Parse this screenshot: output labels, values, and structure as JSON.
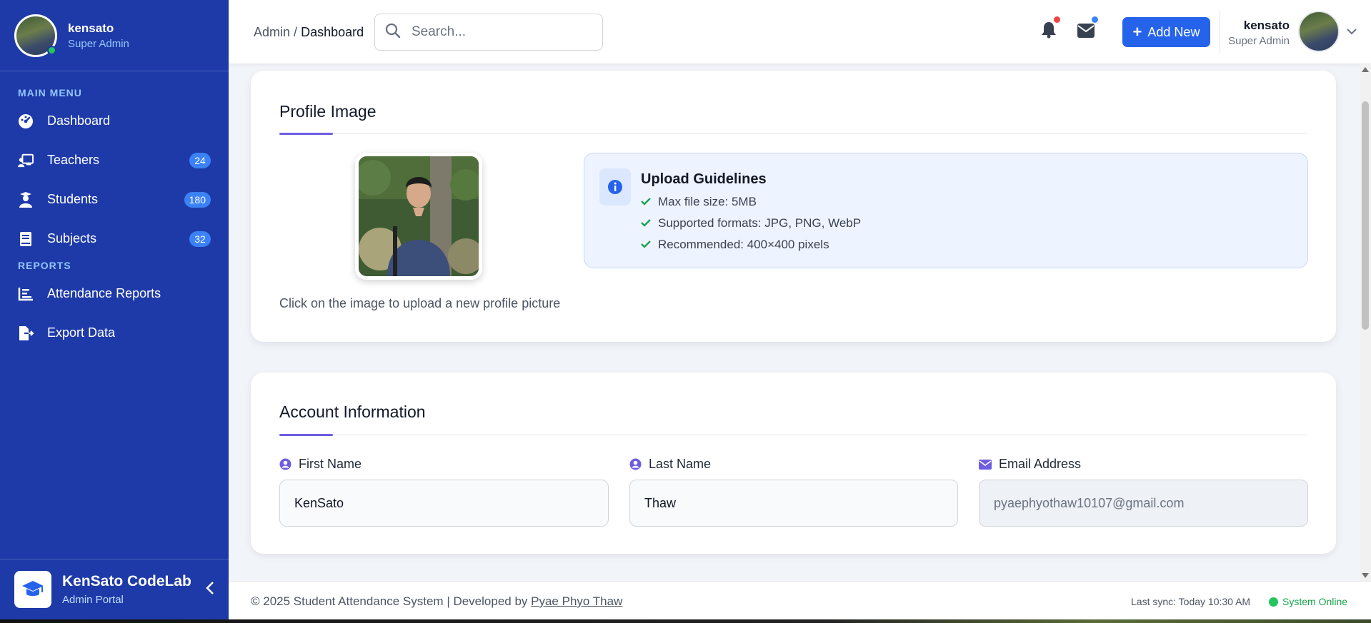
{
  "sidebar": {
    "user": {
      "name": "kensato",
      "role": "Super Admin"
    },
    "sections": {
      "main": "MAIN MENU",
      "reports": "REPORTS"
    },
    "items": [
      {
        "label": "Dashboard",
        "icon": "gauge-icon"
      },
      {
        "label": "Teachers",
        "icon": "chalkboard-teacher-icon",
        "badge": "24"
      },
      {
        "label": "Students",
        "icon": "graduate-icon",
        "badge": "180"
      },
      {
        "label": "Subjects",
        "icon": "book-icon",
        "badge": "32"
      },
      {
        "label": "Attendance Reports",
        "icon": "bar-chart-icon"
      },
      {
        "label": "Export Data",
        "icon": "file-export-icon"
      }
    ],
    "brand": {
      "name": "KenSato CodeLab",
      "subtitle": "Admin Portal",
      "icon": "graduation-cap-icon"
    }
  },
  "header": {
    "breadcrumb": {
      "parent": "Admin",
      "separator": "/",
      "current": "Dashboard"
    },
    "search": {
      "placeholder": "Search...",
      "value": ""
    },
    "add_button": "Add New",
    "user": {
      "name": "kensato",
      "role": "Super Admin"
    }
  },
  "profile_image": {
    "title": "Profile Image",
    "hint": "Click on the image to upload a new profile picture",
    "guidelines": {
      "title": "Upload Guidelines",
      "items": [
        "Max file size: 5MB",
        "Supported formats: JPG, PNG, WebP",
        "Recommended: 400×400 pixels"
      ]
    }
  },
  "account": {
    "title": "Account Information",
    "fields": [
      {
        "label": "First Name",
        "value": "KenSato",
        "icon": "user-circle-icon"
      },
      {
        "label": "Last Name",
        "value": "Thaw",
        "icon": "user-circle-icon"
      },
      {
        "label": "Email Address",
        "value": "pyaephyothaw10107@gmail.com",
        "icon": "envelope-icon",
        "disabled": true
      }
    ]
  },
  "footer": {
    "copyright_prefix": "© 2025 Student Attendance System | Developed by ",
    "developer": "Pyae Phyo Thaw",
    "last_sync": "Last sync: Today 10:30 AM",
    "status": "System Online"
  },
  "colors": {
    "sidebar": "#1e3aa8",
    "accent": "#2563eb",
    "badge": "#3b82f6",
    "online": "#22c55e",
    "notification_dot": "#ef4444",
    "message_dot": "#3b82f6",
    "title_underline": "#6d5de0"
  }
}
